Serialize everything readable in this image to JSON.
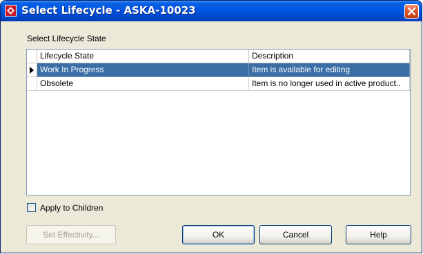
{
  "window": {
    "title": "Select Lifecycle - ASKA-10023",
    "title_bar_color": "#0054e3",
    "icon": "app-icon",
    "close_icon": "close-icon"
  },
  "group": {
    "label": "Select Lifecycle State"
  },
  "grid": {
    "columns": [
      "Lifecycle State",
      "Description"
    ],
    "rows": [
      {
        "state": "Work In Progress",
        "description": "Item is available for editing",
        "selected": true
      },
      {
        "state": "Obsolete",
        "description": "Item is no longer used in active product..",
        "selected": false
      }
    ],
    "selection_color": "#3a6ea5"
  },
  "apply_to_children": {
    "label": "Apply to Children",
    "checked": false
  },
  "buttons": {
    "set_effectivity": "Set Effectivity...",
    "ok": "OK",
    "cancel": "Cancel",
    "help": "Help"
  }
}
